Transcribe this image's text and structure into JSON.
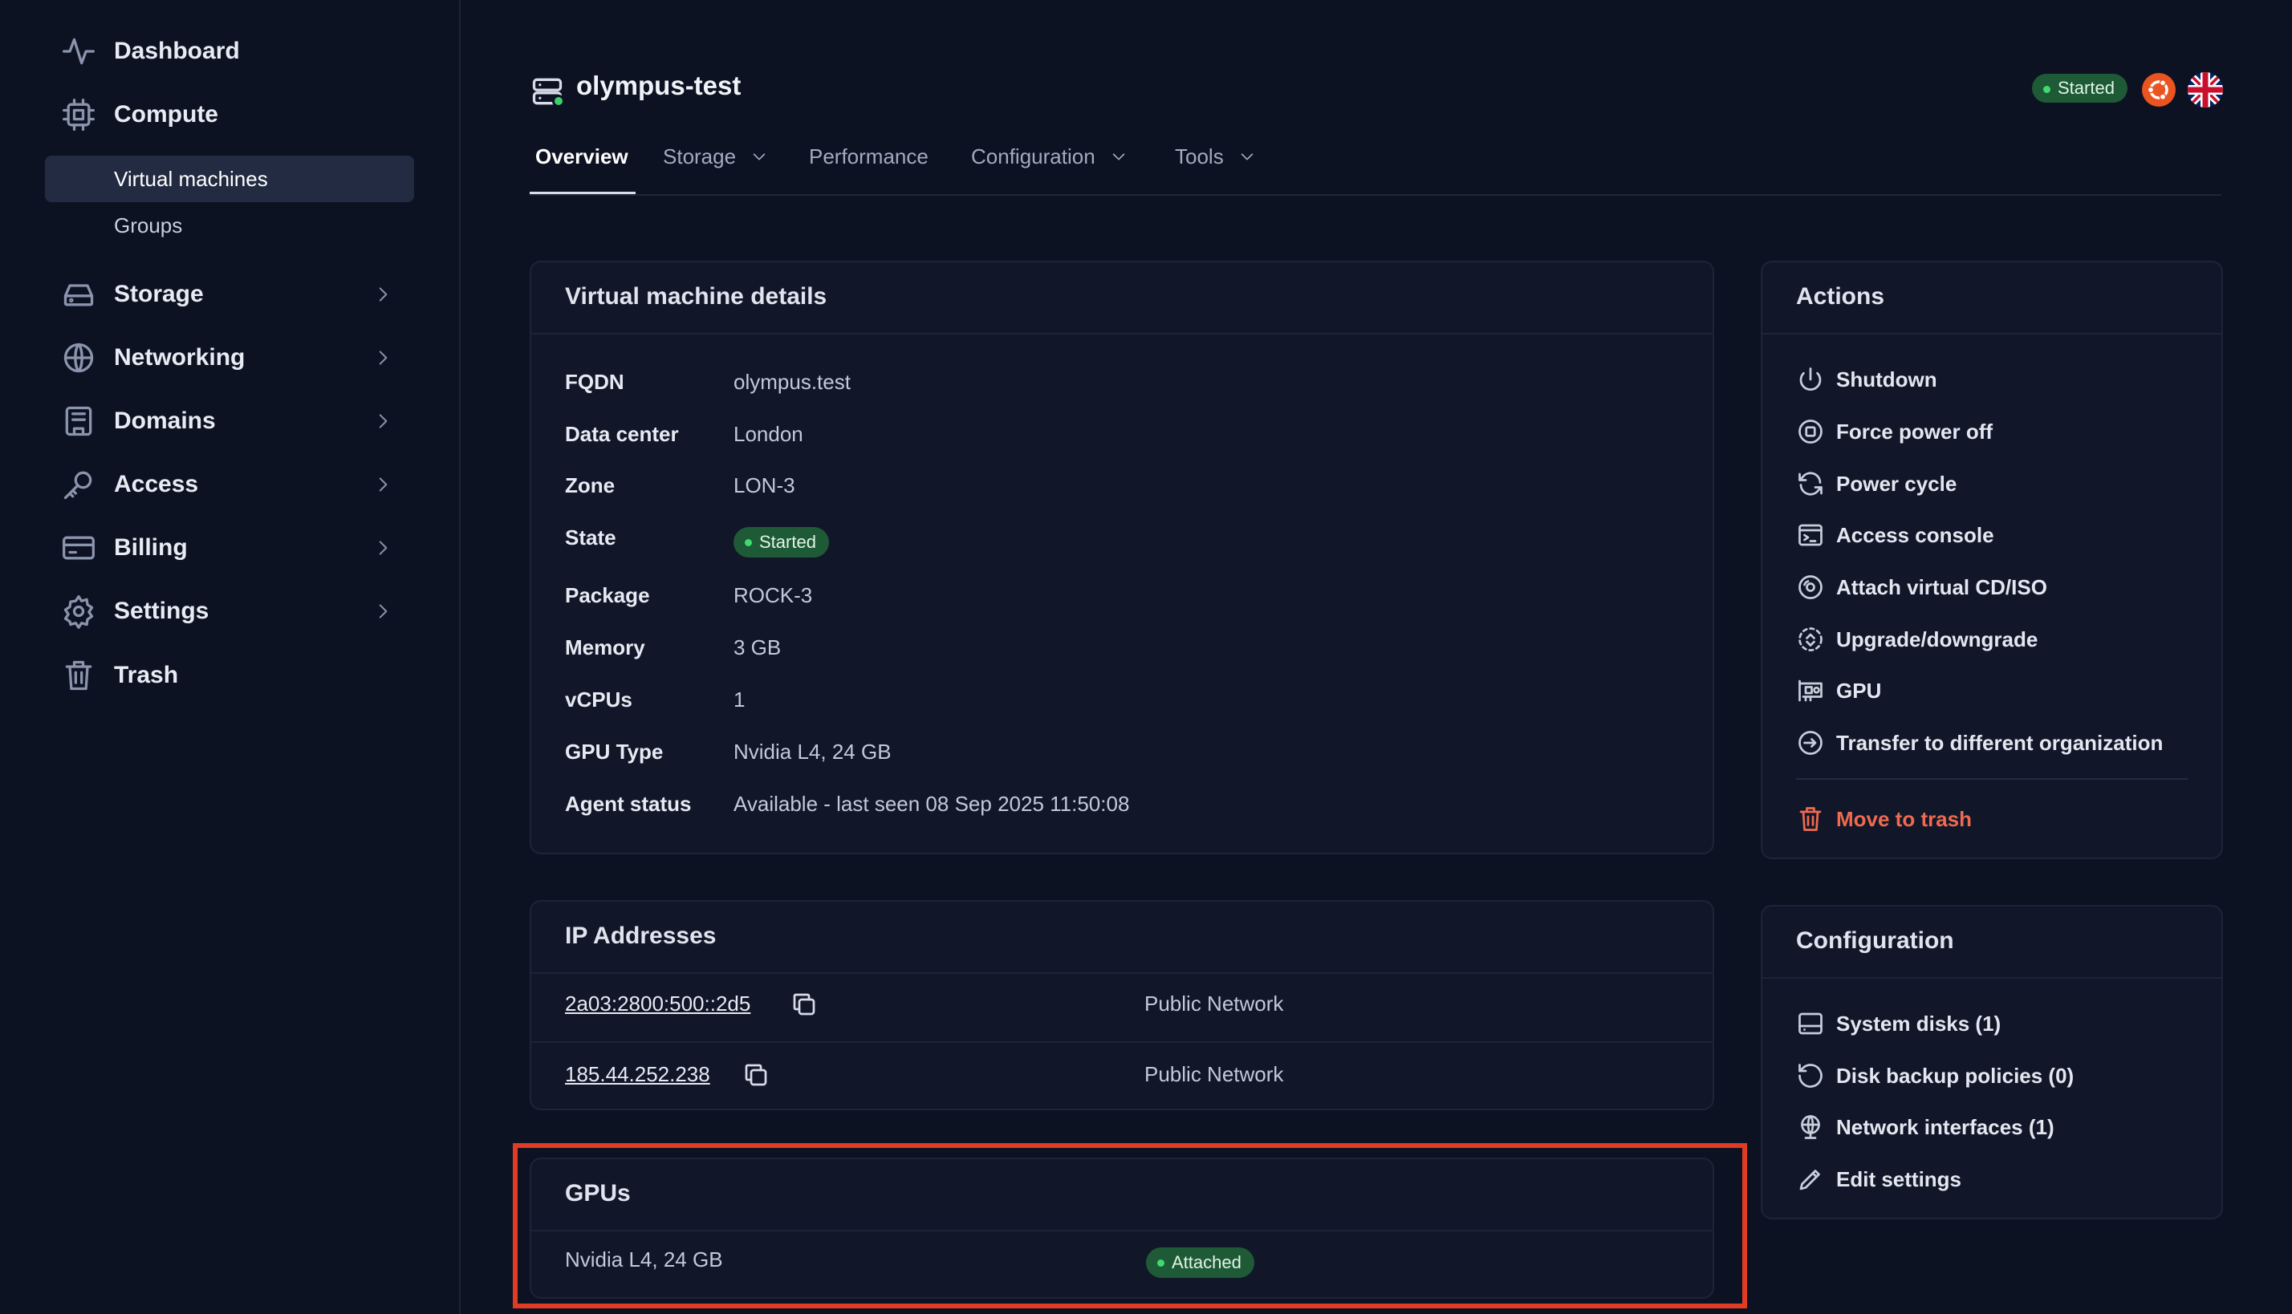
{
  "sidebar": {
    "items": [
      {
        "label": "Dashboard",
        "icon": "activity-icon"
      },
      {
        "label": "Compute",
        "icon": "cpu-icon"
      },
      {
        "label": "Storage",
        "icon": "hard-drive-icon"
      },
      {
        "label": "Networking",
        "icon": "globe-icon"
      },
      {
        "label": "Domains",
        "icon": "domain-icon"
      },
      {
        "label": "Access",
        "icon": "key-icon"
      },
      {
        "label": "Billing",
        "icon": "credit-card-icon"
      },
      {
        "label": "Settings",
        "icon": "gear-icon"
      },
      {
        "label": "Trash",
        "icon": "trash-icon"
      }
    ],
    "compute_sub": [
      "Virtual machines",
      "Groups"
    ]
  },
  "header": {
    "title": "olympus-test",
    "status": "Started"
  },
  "tabs": [
    "Overview",
    "Storage",
    "Performance",
    "Configuration",
    "Tools"
  ],
  "details": {
    "title": "Virtual machine details",
    "rows": [
      {
        "key": "FQDN",
        "value": "olympus.test"
      },
      {
        "key": "Data center",
        "value": "London"
      },
      {
        "key": "Zone",
        "value": "LON-3"
      },
      {
        "key": "State",
        "value": "Started"
      },
      {
        "key": "Package",
        "value": "ROCK-3"
      },
      {
        "key": "Memory",
        "value": "3 GB"
      },
      {
        "key": "vCPUs",
        "value": "1"
      },
      {
        "key": "GPU Type",
        "value": "Nvidia L4, 24 GB"
      },
      {
        "key": "Agent status",
        "value": "Available - last seen 08 Sep 2025 11:50:08"
      }
    ]
  },
  "ip_addresses": {
    "title": "IP Addresses",
    "rows": [
      {
        "address": "2a03:2800:500::2d5",
        "network": "Public Network"
      },
      {
        "address": "185.44.252.238",
        "network": "Public Network"
      }
    ]
  },
  "gpus": {
    "title": "GPUs",
    "rows": [
      {
        "name": "Nvidia L4, 24 GB",
        "status": "Attached"
      }
    ]
  },
  "actions": {
    "title": "Actions",
    "items": [
      "Shutdown",
      "Force power off",
      "Power cycle",
      "Access console",
      "Attach virtual CD/ISO",
      "Upgrade/downgrade",
      "GPU",
      "Transfer to different organization"
    ],
    "danger": "Move to trash"
  },
  "configuration": {
    "title": "Configuration",
    "items": [
      "System disks (1)",
      "Disk backup policies (0)",
      "Network interfaces (1)",
      "Edit settings"
    ]
  },
  "colors": {
    "background": "#0d1222",
    "panel": "#111729",
    "success": "#1f5a36",
    "danger": "#ef6a4e",
    "highlight": "#e23b23"
  }
}
